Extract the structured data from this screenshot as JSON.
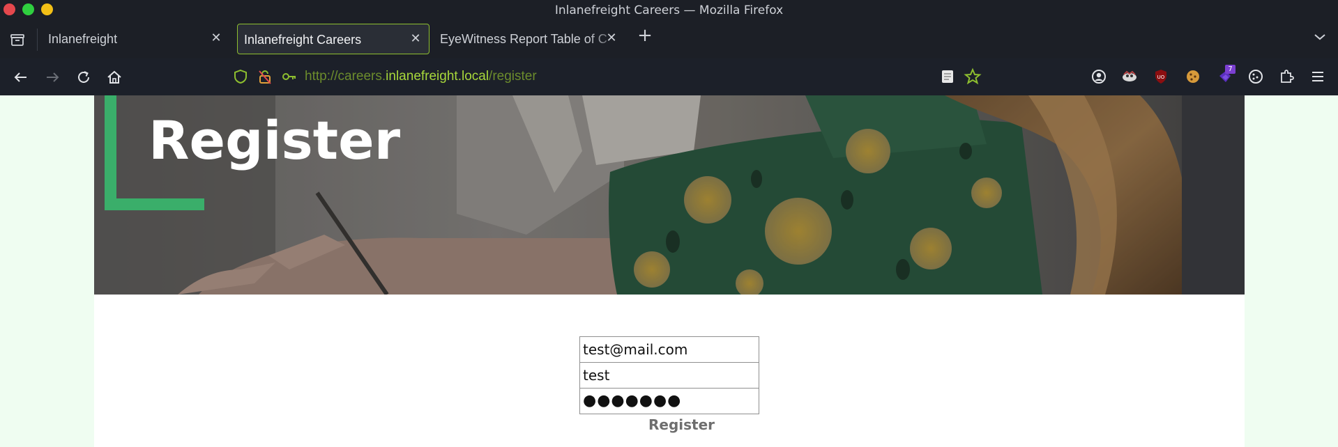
{
  "window": {
    "title": "Inlanefreight Careers — Mozilla Firefox",
    "controls": [
      "close",
      "maximize",
      "minimize"
    ]
  },
  "tabs": [
    {
      "label": "Inlanefreight",
      "active": false
    },
    {
      "label": "Inlanefreight Careers",
      "active": true
    },
    {
      "label": "EyeWitness Report Table of C",
      "active": false
    }
  ],
  "tab_close_glyph": "✕",
  "new_tab_glyph": "+",
  "navbar": {
    "url_prefix": "http://careers.",
    "url_host": "inlanefreight.local",
    "url_path": "/register",
    "extension_badge": "7"
  },
  "icons": [
    "tab-overview-icon",
    "back-icon",
    "forward-icon",
    "reload-icon",
    "home-icon",
    "tracking-shield-icon",
    "insecure-lock-icon",
    "key-icon",
    "reader-view-icon",
    "bookmark-star-icon",
    "account-icon",
    "extension-icon",
    "ublock-icon",
    "cookie-icon",
    "extension-badge-icon",
    "cookie-editor-icon",
    "extensions-puzzle-icon",
    "menu-icon",
    "tab-list-chevron-icon"
  ],
  "colors": {
    "accent_green": "#8ebf2f",
    "url_host": "#a8d83b",
    "bracket_green": "#3aae6a",
    "page_bg": "#effdf1"
  },
  "hero": {
    "title": "Register"
  },
  "form": {
    "email_value": "test@mail.com",
    "username_value": "test",
    "password_mask": "●●●●●●●",
    "submit_label": "Register"
  }
}
